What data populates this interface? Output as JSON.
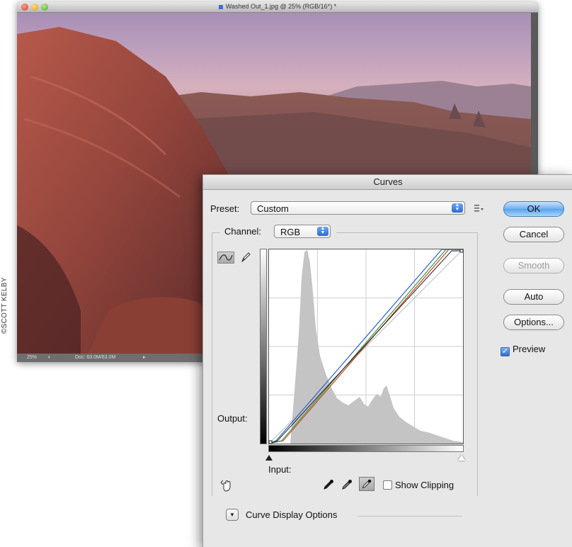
{
  "credit": "©SCOTT KELBY",
  "document": {
    "title": "Washed Out_1.jpg @ 25% (RGB/16*) *",
    "status_zoom": "25%",
    "status_doc": "Doc: 63.0M/63.0M"
  },
  "dialog": {
    "title": "Curves",
    "preset_label": "Preset:",
    "preset_value": "Custom",
    "channel_label": "Channel:",
    "channel_value": "RGB",
    "output_label": "Output:",
    "input_label": "Input:",
    "show_clipping_label": "Show Clipping",
    "show_clipping_checked": false,
    "curve_display_options_label": "Curve Display Options",
    "buttons": {
      "ok": "OK",
      "cancel": "Cancel",
      "smooth": "Smooth",
      "auto": "Auto",
      "options": "Options..."
    },
    "preview_label": "Preview",
    "preview_checked": true
  },
  "colors": {
    "default_button": "#5aa2ea",
    "histogram": "#c4c4c4",
    "curve_rgb": "#1a1a1a",
    "curve_red": "#d0402f",
    "curve_green": "#3f9b3a",
    "curve_blue": "#2f5fcf"
  },
  "icons": {
    "preset_menu": "preset-options-icon",
    "curve_tool": "curve-point-icon",
    "pencil_tool": "pencil-icon",
    "hand_tool": "on-image-adjust-icon",
    "black_point": "black-eyedropper-icon",
    "gray_point": "gray-eyedropper-icon",
    "white_point": "white-eyedropper-icon",
    "disclosure": "disclosure-triangle-icon"
  }
}
